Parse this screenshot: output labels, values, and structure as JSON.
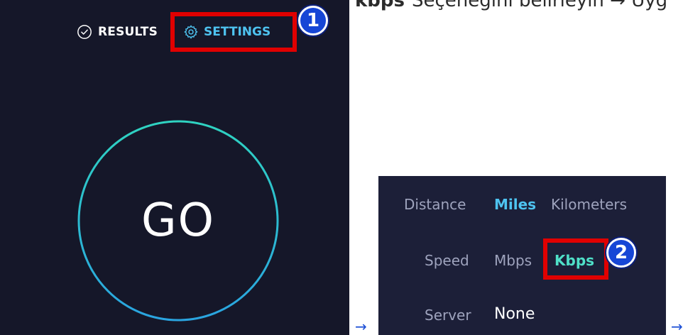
{
  "top_text": {
    "bold": "kbps",
    "rest": "Seçeneğini belirleyin → Uyg"
  },
  "header": {
    "results_label": "RESULTS",
    "settings_label": "SETTINGS"
  },
  "badges": {
    "step1": "1",
    "step2": "2"
  },
  "go_button": {
    "label": "GO"
  },
  "arrows": {
    "first": "→",
    "second": "→"
  },
  "settings_panel": {
    "distance": {
      "label": "Distance",
      "options": [
        "Miles",
        "Kilometers"
      ],
      "selected": "Miles"
    },
    "speed": {
      "label": "Speed",
      "options": [
        "Mbps",
        "Kbps"
      ],
      "selected": "Kbps"
    },
    "server": {
      "label": "Server",
      "value": "None"
    }
  },
  "colors": {
    "left_bg": "#151729",
    "panel_bg": "#1c1f38",
    "accent_blue": "#4ec3f0",
    "accent_teal": "#4fe0c8",
    "highlight_red": "#e00000",
    "badge_blue": "#1646d6"
  }
}
